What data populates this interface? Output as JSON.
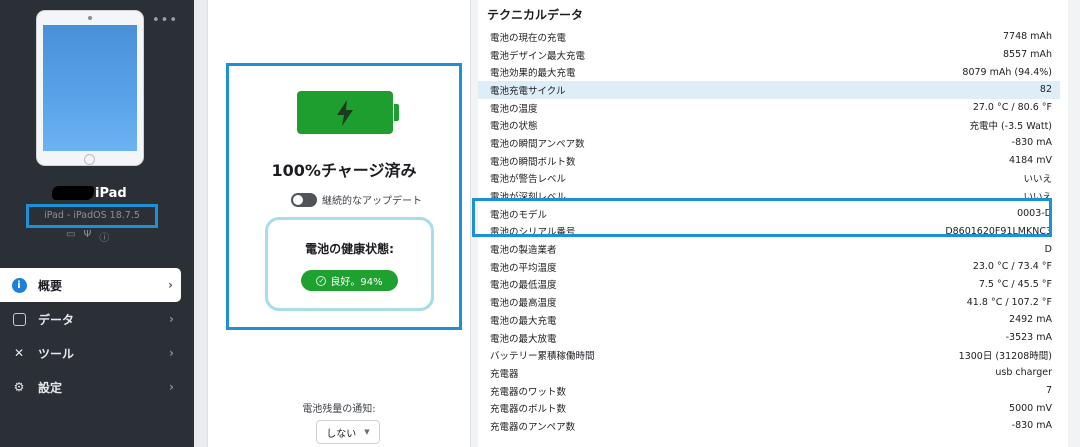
{
  "sidebar": {
    "device_name": "iPad",
    "device_sub": "iPad - iPadOS 18.7.5",
    "more": "•••",
    "nav": [
      {
        "label": "概要",
        "icon": "info-icon",
        "active": true
      },
      {
        "label": "データ",
        "icon": "square-icon",
        "active": false
      },
      {
        "label": "ツール",
        "icon": "tools-icon",
        "active": false
      },
      {
        "label": "設定",
        "icon": "gear-icon",
        "active": false
      }
    ]
  },
  "battery_panel": {
    "charge_title": "100%チャージ済み",
    "toggle_label": "継続的なアップデート",
    "toggle_on": false,
    "health_title": "電池の健康状態:",
    "health_value": "良好。94%",
    "notify_label": "電池残量の通知:",
    "notify_select": "しない"
  },
  "tech": {
    "title": "テクニカルデータ",
    "rows": [
      {
        "label": "電池の現在の充電",
        "value": "7748 mAh"
      },
      {
        "label": "電池デザイン最大充電",
        "value": "8557 mAh"
      },
      {
        "label": "電池効果的最大充電",
        "value": "8079 mAh (94.4%)"
      },
      {
        "label": "電池充電サイクル",
        "value": "82"
      },
      {
        "label": "電池の温度",
        "value": "27.0 °C / 80.6 °F"
      },
      {
        "label": "電池の状態",
        "value": "充電中 (-3.5 Watt)"
      },
      {
        "label": "電池の瞬間アンペア数",
        "value": "-830 mA"
      },
      {
        "label": "電池の瞬間ボルト数",
        "value": "4184 mV"
      },
      {
        "label": "電池が警告レベル",
        "value": "いいえ"
      },
      {
        "label": "電池が深刻レベル",
        "value": "いいえ"
      },
      {
        "label": "電池のモデル",
        "value": "0003-D"
      },
      {
        "label": "電池のシリアル番号",
        "value": "D8601620F91LMKNC3"
      },
      {
        "label": "電池の製造業者",
        "value": "D"
      },
      {
        "label": "電池の平均温度",
        "value": "23.0 °C / 73.4 °F"
      },
      {
        "label": "電池の最低温度",
        "value": "7.5 °C / 45.5 °F"
      },
      {
        "label": "電池の最高温度",
        "value": "41.8 °C / 107.2 °F"
      },
      {
        "label": "電池の最大充電",
        "value": "2492 mA"
      },
      {
        "label": "電池の最大放電",
        "value": "-3523 mA"
      },
      {
        "label": "バッテリー累積稼働時間",
        "value": "1300日 (31208時間)"
      },
      {
        "label": "充電器",
        "value": "usb charger"
      },
      {
        "label": "充電器のワット数",
        "value": "7"
      },
      {
        "label": "充電器のボルト数",
        "value": "5000 mV"
      },
      {
        "label": "充電器のアンペア数",
        "value": "-830 mA"
      }
    ]
  },
  "colors": {
    "accent": "#1e90d6",
    "battery_green": "#1e9e2e",
    "sidebar_bg": "#2b2f36",
    "highlight_row": "#ddeef9"
  }
}
